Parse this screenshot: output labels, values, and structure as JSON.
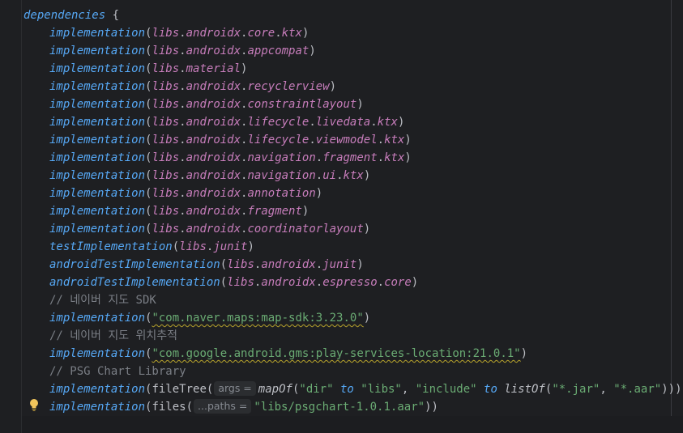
{
  "editor": {
    "block_keyword": "dependencies",
    "open_brace": "{",
    "lib_prefix": "libs",
    "lines": [
      {
        "fn": "implementation",
        "path": [
          "androidx",
          "core",
          "ktx"
        ]
      },
      {
        "fn": "implementation",
        "path": [
          "androidx",
          "appcompat"
        ]
      },
      {
        "fn": "implementation",
        "path": [
          "material"
        ]
      },
      {
        "fn": "implementation",
        "path": [
          "androidx",
          "recyclerview"
        ]
      },
      {
        "fn": "implementation",
        "path": [
          "androidx",
          "constraintlayout"
        ]
      },
      {
        "fn": "implementation",
        "path": [
          "androidx",
          "lifecycle",
          "livedata",
          "ktx"
        ]
      },
      {
        "fn": "implementation",
        "path": [
          "androidx",
          "lifecycle",
          "viewmodel",
          "ktx"
        ]
      },
      {
        "fn": "implementation",
        "path": [
          "androidx",
          "navigation",
          "fragment",
          "ktx"
        ]
      },
      {
        "fn": "implementation",
        "path": [
          "androidx",
          "navigation",
          "ui",
          "ktx"
        ]
      },
      {
        "fn": "implementation",
        "path": [
          "androidx",
          "annotation"
        ]
      },
      {
        "fn": "implementation",
        "path": [
          "androidx",
          "fragment"
        ]
      },
      {
        "fn": "implementation",
        "path": [
          "androidx",
          "coordinatorlayout"
        ]
      },
      {
        "fn": "testImplementation",
        "path": [
          "junit"
        ]
      },
      {
        "fn": "androidTestImplementation",
        "path": [
          "androidx",
          "junit"
        ]
      },
      {
        "fn": "androidTestImplementation",
        "path": [
          "androidx",
          "espresso",
          "core"
        ]
      }
    ],
    "comment_naver_sdk": "// 네이버 지도 SDK",
    "naver_impl": "implementation",
    "naver_dep": "\"com.naver.maps:map-sdk:3.23.0\"",
    "comment_location": "// 네이버 지도 위치추적",
    "gms_impl": "implementation",
    "gms_dep": "\"com.google.android.gms:play-services-location:21.0.1\"",
    "comment_psg": "// PSG Chart Library",
    "filetree_line": {
      "fn": "implementation",
      "call": "fileTree(",
      "hint": "args =",
      "mapof": "mapOf",
      "dir_key": "\"dir\"",
      "to1": "to",
      "dir_val": "\"libs\"",
      "include_key": "\"include\"",
      "to2": "to",
      "listof": "listOf",
      "jar": "\"*.jar\"",
      "aar": "\"*.aar\"",
      "close": "))))"
    },
    "files_line": {
      "fn": "implementation",
      "call": "files(",
      "hint": "...paths =",
      "path": "\"libs/psgchart-1.0.1.aar\"",
      "close": "))"
    }
  },
  "colors": {
    "background": "#1e1f22",
    "function": "#56a8f5",
    "property": "#c77dbb",
    "string": "#6aab73",
    "comment": "#7a7e85",
    "warning_underline": "#b8a42c",
    "bulb": "#f2c55c"
  },
  "icons": {
    "intention": "lightbulb-icon"
  }
}
